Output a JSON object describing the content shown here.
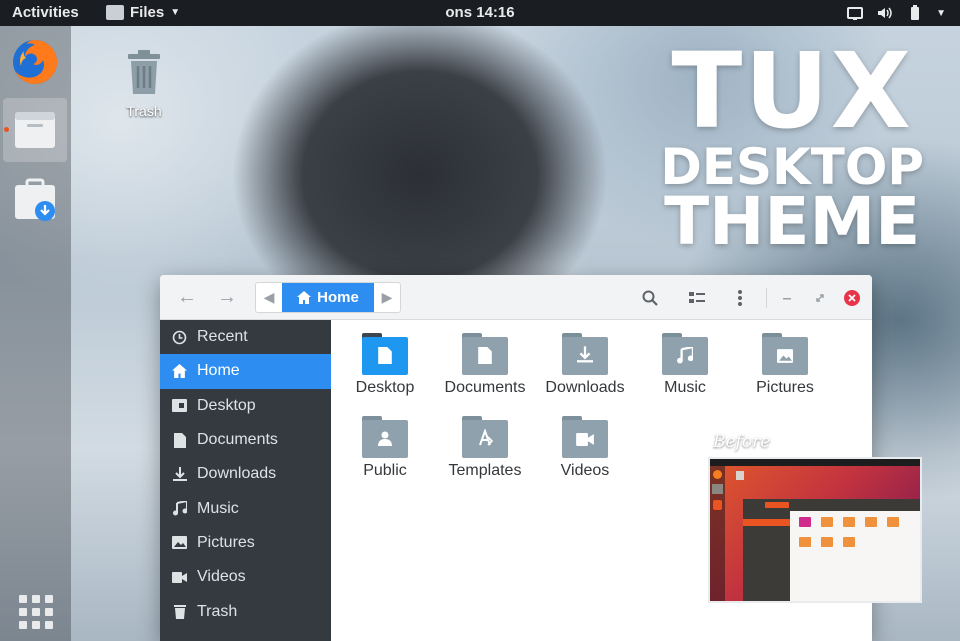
{
  "topbar": {
    "activities": "Activities",
    "app_menu": "Files",
    "clock": "ons 14:16"
  },
  "desktop": {
    "trash_label": "Trash",
    "headline": {
      "line1": "TUX",
      "line2": "DESKTOP",
      "line3": "THEME"
    }
  },
  "dock": {
    "items": [
      "firefox-icon",
      "files-icon",
      "software-install-icon"
    ],
    "show_apps": "app-grid-icon"
  },
  "window": {
    "path": {
      "current": "Home"
    },
    "sidebar": [
      {
        "label": "Recent",
        "icon": "clock-icon"
      },
      {
        "label": "Home",
        "icon": "home-icon",
        "selected": true
      },
      {
        "label": "Desktop",
        "icon": "desktop-icon"
      },
      {
        "label": "Documents",
        "icon": "document-icon"
      },
      {
        "label": "Downloads",
        "icon": "download-icon"
      },
      {
        "label": "Music",
        "icon": "music-icon"
      },
      {
        "label": "Pictures",
        "icon": "picture-icon"
      },
      {
        "label": "Videos",
        "icon": "video-icon"
      },
      {
        "label": "Trash",
        "icon": "trash-icon"
      }
    ],
    "files": [
      {
        "name": "Desktop",
        "icon": "desktop-folder-icon"
      },
      {
        "name": "Documents",
        "icon": "documents-folder-icon"
      },
      {
        "name": "Downloads",
        "icon": "downloads-folder-icon"
      },
      {
        "name": "Music",
        "icon": "music-folder-icon"
      },
      {
        "name": "Pictures",
        "icon": "pictures-folder-icon"
      },
      {
        "name": "Public",
        "icon": "public-folder-icon"
      },
      {
        "name": "Templates",
        "icon": "templates-folder-icon"
      },
      {
        "name": "Videos",
        "icon": "videos-folder-icon"
      }
    ]
  },
  "before_inset": {
    "label": "Before"
  },
  "colors": {
    "accent": "#2d8df0",
    "sidebar_bg": "#353a40",
    "folder": "#8fa1ad",
    "folder_accent": "#1e97f0",
    "close": "#e8334a"
  }
}
